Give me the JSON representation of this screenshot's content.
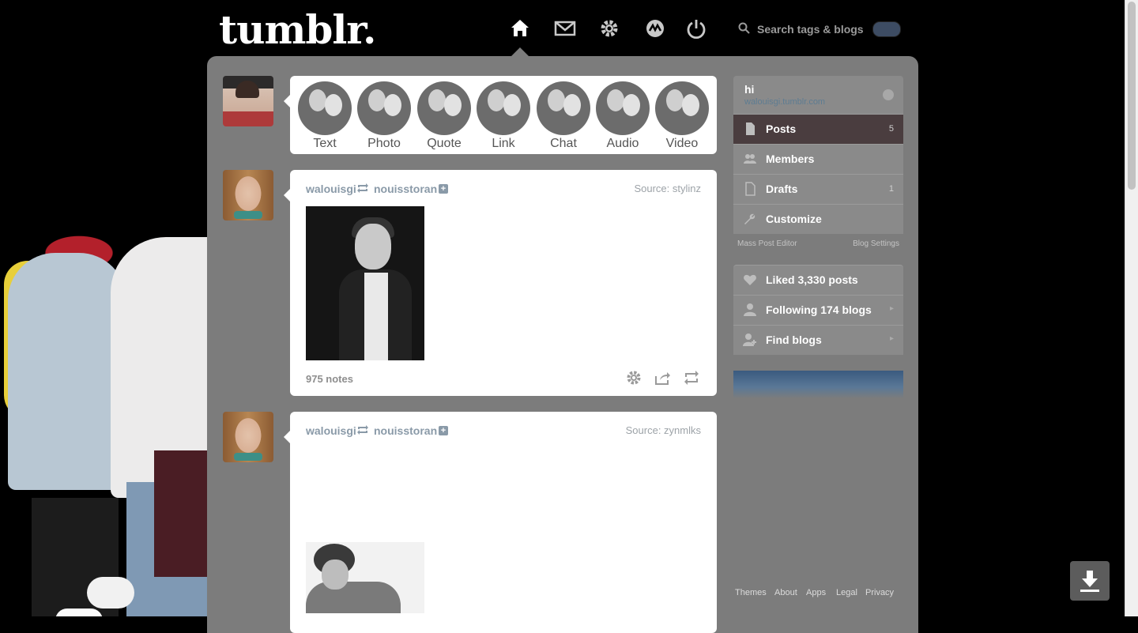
{
  "header": {
    "logo": "tumblr.",
    "nav": [
      "home-icon",
      "mail-icon",
      "gear-icon",
      "activity-icon",
      "power-icon"
    ],
    "search_placeholder": "Search tags & blogs"
  },
  "post_types": [
    "Text",
    "Photo",
    "Quote",
    "Link",
    "Chat",
    "Audio",
    "Video"
  ],
  "posts": [
    {
      "user": "walouisgi",
      "reblogged_from": "nouisstoran",
      "source": "Source: stylinz",
      "notes": "975 notes"
    },
    {
      "user": "walouisgi",
      "reblogged_from": "nouisstoran",
      "source": "Source: zynmlks"
    }
  ],
  "sidebar": {
    "blog_title": "hi",
    "blog_url": "walouisgi.tumblr.com",
    "items": [
      {
        "label": "Posts",
        "count": "5",
        "icon": "document-icon"
      },
      {
        "label": "Members",
        "icon": "members-icon"
      },
      {
        "label": "Drafts",
        "count": "1",
        "icon": "drafts-icon"
      },
      {
        "label": "Customize",
        "icon": "wrench-icon"
      }
    ],
    "mass_post_editor": "Mass Post Editor",
    "blog_settings": "Blog Settings",
    "liked": "Liked 3,330 posts",
    "following": "Following 174 blogs",
    "find_blogs": "Find blogs",
    "accent_color": "#4a3d3f"
  },
  "footer": [
    "Themes",
    "About",
    "Apps",
    "Legal",
    "Privacy"
  ]
}
